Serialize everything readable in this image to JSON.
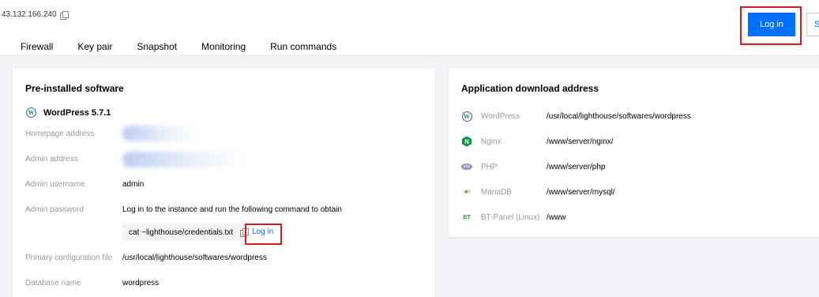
{
  "header": {
    "ip": "43.132.166.240",
    "login_label": "Log in",
    "cut_button_label": "S"
  },
  "tabs": [
    {
      "label": "Firewall"
    },
    {
      "label": "Key pair"
    },
    {
      "label": "Snapshot"
    },
    {
      "label": "Monitoring"
    },
    {
      "label": "Run commands"
    }
  ],
  "preinstalled": {
    "title": "Pre-installed software",
    "software_name": "WordPress 5.7.1",
    "fields": {
      "homepage_label": "Homepage address",
      "admin_address_label": "Admin address",
      "admin_username_label": "Admin username",
      "admin_username_value": "admin",
      "admin_password_label": "Admin password",
      "admin_password_hint": "Log in to the instance and run the following command to obtain",
      "command": "cat ~lighthouse/credentials.txt",
      "login_label": "Log in",
      "primary_config_label": "Primary configuration file",
      "primary_config_value": "/usr/local/lighthouse/softwares/wordpress",
      "database_name_label": "Database name",
      "database_name_value": "wordpress"
    }
  },
  "app_download": {
    "title": "Application download address",
    "apps": [
      {
        "name": "WordPress",
        "path": "/usr/local/lighthouse/softwares/wordpress",
        "icon": "wordpress-icon"
      },
      {
        "name": "Nginx",
        "path": "/www/server/nginx/",
        "icon": "nginx-icon"
      },
      {
        "name": "PHP",
        "path": "/www/server/php",
        "icon": "php-icon"
      },
      {
        "name": "MariaDB",
        "path": "/www/server/mysql/",
        "icon": "mariadb-icon"
      },
      {
        "name": "BT-Panel (Linux)",
        "path": "/www",
        "icon": "bt-panel-icon"
      }
    ]
  },
  "colors": {
    "primary": "#006eff",
    "highlight_outline": "#e0161b",
    "label_gray": "#999999",
    "nginx_green": "#009639",
    "wordpress_blue": "#21759b"
  }
}
